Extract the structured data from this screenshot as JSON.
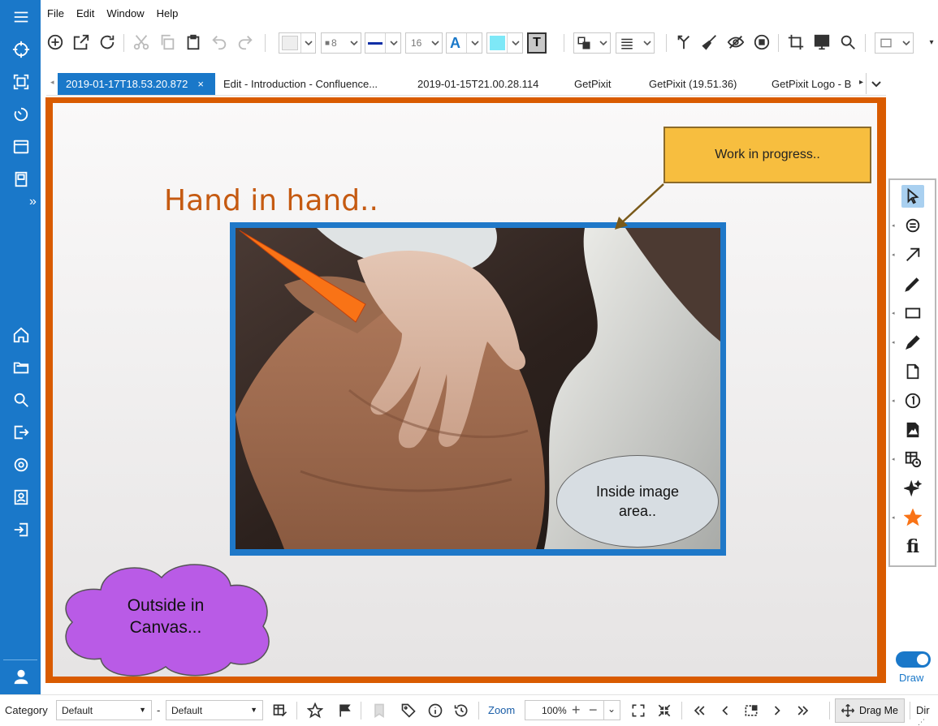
{
  "menu": [
    "File",
    "Edit",
    "Window",
    "Help"
  ],
  "toolbar": {
    "border_size": "8",
    "font_size": "16",
    "text_letter": "A",
    "text_button_letter": "T"
  },
  "tabs": [
    {
      "label": "2019-01-17T18.53.20.872",
      "active": true,
      "close": "×"
    },
    {
      "label": "Edit - Introduction - Confluence...",
      "active": false
    },
    {
      "label": "2019-01-15T21.00.28.114",
      "active": false
    },
    {
      "label": "GetPixit",
      "active": false
    },
    {
      "label": "GetPixit (19.51.36)",
      "active": false
    },
    {
      "label": "GetPixit Logo - B",
      "active": false
    }
  ],
  "canvas": {
    "heading": "Hand in hand..",
    "callout": "Work in progress..",
    "ellipse": "Inside image area..",
    "cloud": "Outside in Canvas...",
    "colors": {
      "frame": "#d95b00",
      "image_border": "#1f78c8",
      "heading": "#c55a11",
      "callout_fill": "#f7be3f",
      "arrow": "#f97316",
      "cloud_fill": "#b95be6"
    }
  },
  "palette": {
    "tools": [
      "pointer-icon",
      "comment-icon",
      "arrow-icon",
      "pen-icon",
      "rectangle-icon",
      "marker-icon",
      "page-icon",
      "number-icon",
      "image-file-icon",
      "table-time-icon",
      "sparkle-icon",
      "star-icon",
      "fi-icon"
    ],
    "fi_text": "fi",
    "draw_label": "Draw",
    "draw_on": true
  },
  "status": {
    "category_label": "Category",
    "category_value": "Default",
    "dash": "-",
    "second_value": "Default",
    "zoom_label": "Zoom",
    "zoom_value": "100%",
    "drag_label": "Drag Me",
    "dir_label": "Dir"
  }
}
